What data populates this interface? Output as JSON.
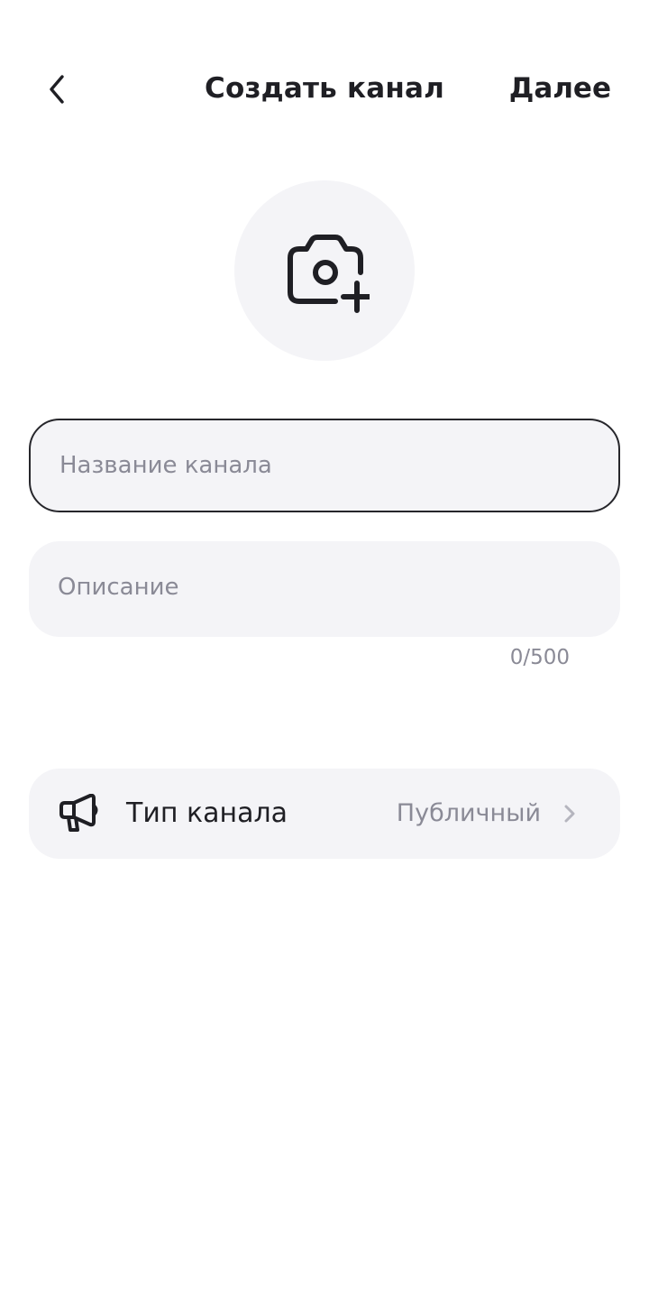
{
  "header": {
    "title": "Создать канал",
    "next_label": "Далее"
  },
  "avatar": {
    "icon": "camera-plus-icon"
  },
  "form": {
    "name_placeholder": "Название канала",
    "name_value": "",
    "description_placeholder": "Описание",
    "description_value": "",
    "description_counter": "0/500"
  },
  "channel_type": {
    "icon": "megaphone-icon",
    "label": "Тип канала",
    "value": "Публичный"
  },
  "colors": {
    "text": "#1f1f24",
    "secondary_text": "#8a8a96",
    "field_background": "#f4f4f7",
    "focused_border": "#26262b",
    "background": "#ffffff"
  }
}
